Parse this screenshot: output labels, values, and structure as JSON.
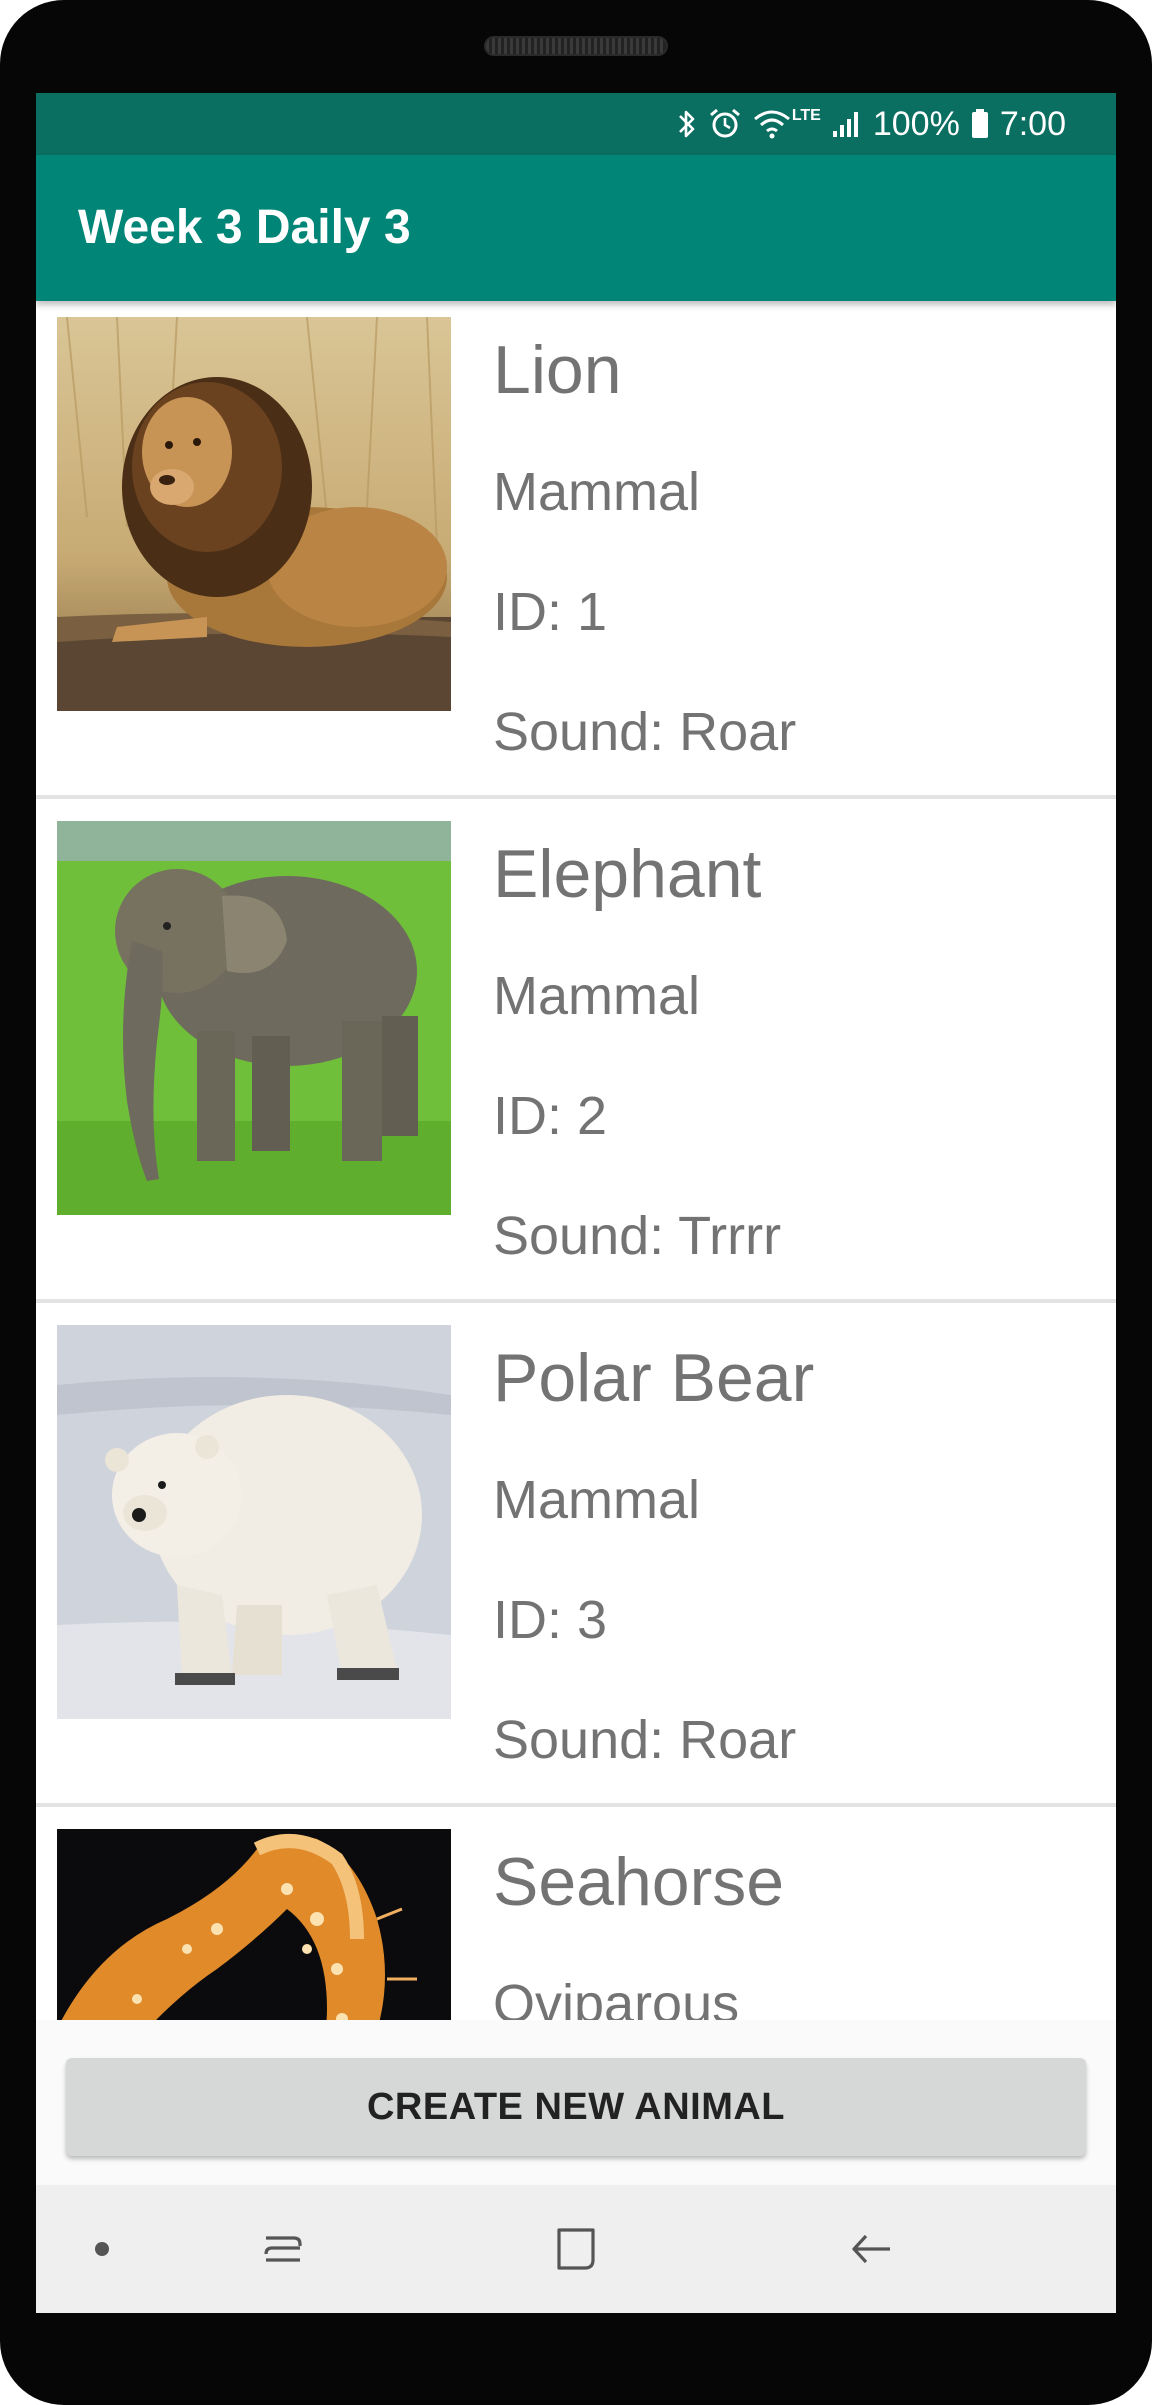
{
  "status_bar": {
    "battery": "100%",
    "time": "7:00",
    "network": "LTE",
    "icons": [
      "bluetooth-icon",
      "alarm-icon",
      "wifi-icon",
      "signal-icon",
      "battery-icon"
    ]
  },
  "app_bar": {
    "title": "Week 3 Daily 3"
  },
  "animals": [
    {
      "name": "Lion",
      "type": "Mammal",
      "id": "ID: 1",
      "sound": "Sound: Roar"
    },
    {
      "name": "Elephant",
      "type": "Mammal",
      "id": "ID: 2",
      "sound": "Sound: Trrrr"
    },
    {
      "name": "Polar Bear",
      "type": "Mammal",
      "id": "ID: 3",
      "sound": "Sound: Roar"
    },
    {
      "name": "Seahorse",
      "type": "Oviparous"
    }
  ],
  "actions": {
    "create_label": "CREATE NEW ANIMAL"
  },
  "nav_bar": {
    "icons": [
      "dot-icon",
      "recent-apps-icon",
      "home-icon",
      "back-icon"
    ]
  },
  "colors": {
    "status_bar": "#0a6e60",
    "app_bar": "#008577",
    "text_secondary": "#737373"
  }
}
